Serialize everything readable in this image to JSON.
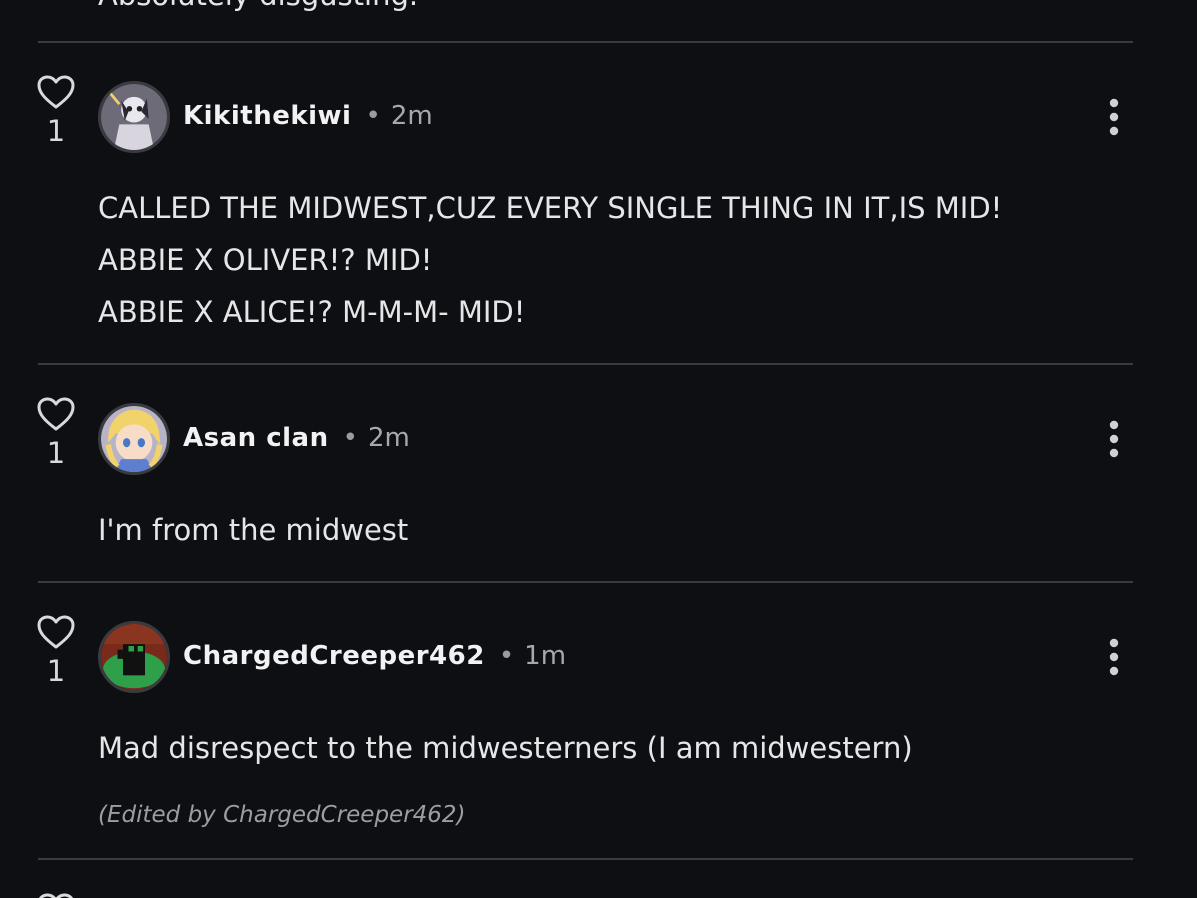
{
  "previous_comment": {
    "tail_text": "Absolutely disgusting."
  },
  "comments": [
    {
      "username": "Kikithekiwi",
      "time": "2m",
      "likes": "1",
      "avatar_icon": "avatar-kikithekiwi",
      "body": [
        "CALLED THE MIDWEST,CUZ EVERY SINGLE THING IN IT,IS MID!",
        "ABBIE X OLIVER!? MID!",
        "ABBIE X ALICE!? M-M-M- MID!"
      ]
    },
    {
      "username": "Asan clan",
      "time": "2m",
      "likes": "1",
      "avatar_icon": "avatar-asan-clan",
      "body": [
        "I'm from the midwest"
      ]
    },
    {
      "username": "ChargedCreeper462",
      "time": "1m",
      "likes": "1",
      "avatar_icon": "avatar-chargedcreeper462",
      "body": [
        "Mad disrespect to the midwesterners (I am midwestern)"
      ],
      "edited_note": "(Edited by ChargedCreeper462)"
    }
  ],
  "separator": "•",
  "colors": {
    "background": "#0e0f13",
    "divider": "#3a3b40",
    "text": "#e6e6e8",
    "muted": "#a7a8ad"
  }
}
